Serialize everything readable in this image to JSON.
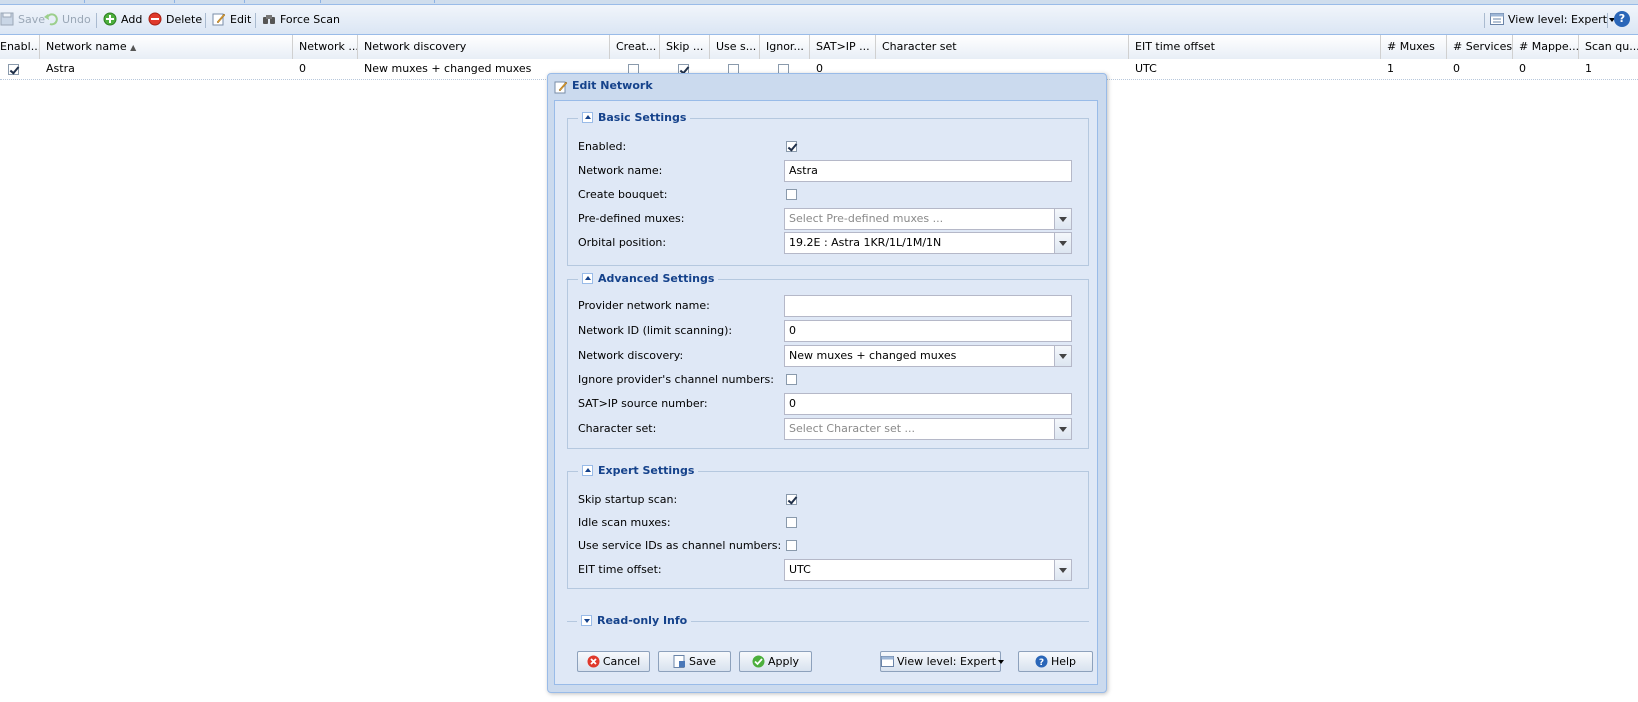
{
  "toolbar": {
    "save": "Save",
    "undo": "Undo",
    "add": "Add",
    "delete": "Delete",
    "edit": "Edit",
    "force_scan": "Force Scan",
    "view_level": "View level: Expert",
    "help_glyph": "?"
  },
  "grid": {
    "columns": [
      "Enabl...",
      "Network name",
      "Network ...",
      "Network discovery",
      "Creat...",
      "Skip ...",
      "Use s...",
      "Ignor...",
      "SAT>IP ...",
      "Character set",
      "EIT time offset",
      "# Muxes",
      "# Services",
      "# Mappe...",
      "Scan qu..."
    ],
    "sort_indicator": "▲",
    "row": {
      "enabled": true,
      "network_name": "Astra",
      "network_id": "0",
      "network_discovery": "New muxes + changed muxes",
      "create_bouquet": false,
      "skip_startup": true,
      "use_sid": false,
      "ignore": false,
      "satip": "0",
      "charset": "",
      "eit_offset": "UTC",
      "muxes": "1",
      "services": "0",
      "mapped": "0",
      "scan_queue": "1"
    }
  },
  "dialog": {
    "title": "Edit Network",
    "basic": {
      "legend": "Basic Settings",
      "enabled_label": "Enabled:",
      "enabled": true,
      "network_name_label": "Network name:",
      "network_name": "Astra",
      "create_bouquet_label": "Create bouquet:",
      "create_bouquet": false,
      "predefined_label": "Pre-defined muxes:",
      "predefined_placeholder": "Select Pre-defined muxes ...",
      "orbital_label": "Orbital position:",
      "orbital_value": "19.2E : Astra 1KR/1L/1M/1N"
    },
    "advanced": {
      "legend": "Advanced Settings",
      "provider_label": "Provider network name:",
      "provider_value": "",
      "network_id_label": "Network ID (limit scanning):",
      "network_id_value": "0",
      "discovery_label": "Network discovery:",
      "discovery_value": "New muxes + changed muxes",
      "ignore_label": "Ignore provider's channel numbers:",
      "ignore": false,
      "satip_label": "SAT>IP source number:",
      "satip_value": "0",
      "charset_label": "Character set:",
      "charset_placeholder": "Select Character set ..."
    },
    "expert": {
      "legend": "Expert Settings",
      "skip_label": "Skip startup scan:",
      "skip": true,
      "idle_label": "Idle scan muxes:",
      "idle": false,
      "sid_label": "Use service IDs as channel numbers:",
      "sid": false,
      "eit_label": "EIT time offset:",
      "eit_value": "UTC"
    },
    "readonly": {
      "legend": "Read-only Info"
    },
    "buttons": {
      "cancel": "Cancel",
      "save": "Save",
      "apply": "Apply",
      "view_level": "View level: Expert",
      "help": "Help"
    }
  },
  "colors": {
    "accent_text": "#15428b",
    "window_bg": "#cbdaee",
    "panel_bg": "#dfe8f6",
    "border": "#99bbe8"
  }
}
